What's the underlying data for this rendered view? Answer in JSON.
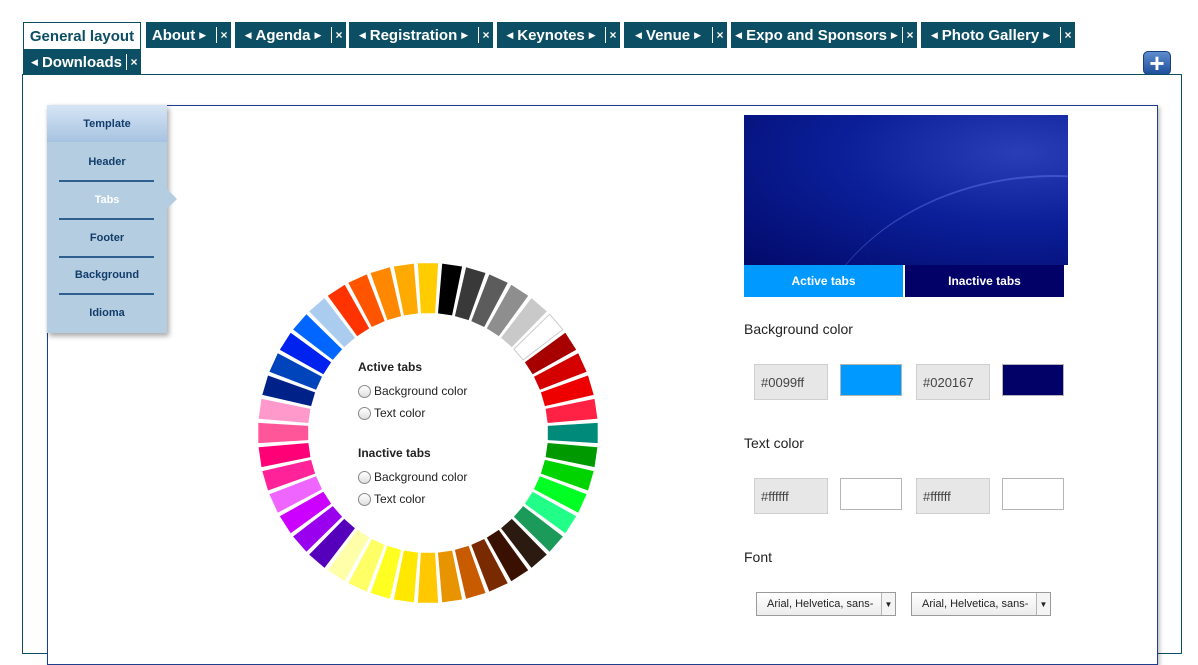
{
  "tabs": [
    {
      "label": "General layout",
      "active": true
    },
    {
      "label": "About",
      "active": false
    },
    {
      "label": "Agenda",
      "active": false
    },
    {
      "label": "Registration",
      "active": false
    },
    {
      "label": "Keynotes",
      "active": false
    },
    {
      "label": "Venue",
      "active": false
    },
    {
      "label": "Expo and Sponsors",
      "active": false
    },
    {
      "label": "Photo Gallery",
      "active": false
    },
    {
      "label": "Downloads",
      "active": false
    }
  ],
  "tab_close_glyph": "×",
  "add_tab_icon": "plus-icon",
  "sidebar": {
    "items": [
      {
        "label": "Template"
      },
      {
        "label": "Header"
      },
      {
        "label": "Tabs",
        "selected": true
      },
      {
        "label": "Footer"
      },
      {
        "label": "Background"
      },
      {
        "label": "Idioma"
      }
    ]
  },
  "wheel": {
    "colors": [
      "#000000",
      "#393939",
      "#5c5c5c",
      "#8e8e8e",
      "#c9c9c9",
      "#ffffff",
      "#a60000",
      "#d40000",
      "#ee0000",
      "#ff2244",
      "#008a7a",
      "#009a00",
      "#00d400",
      "#00ff22",
      "#22ff88",
      "#1c9a5a",
      "#2a1a10",
      "#3a1000",
      "#7a2a00",
      "#c85a00",
      "#e89400",
      "#ffc800",
      "#ffe800",
      "#ffff22",
      "#ffff66",
      "#ffffaa",
      "#5500bb",
      "#9900ee",
      "#cc00ff",
      "#ee66ff",
      "#ff2299",
      "#ff0077",
      "#ff5599",
      "#ff99cc",
      "#002288",
      "#0044bb",
      "#0022ee",
      "#0066ff",
      "#aaccee",
      "#ff3300",
      "#ff5500",
      "#ff8800",
      "#ffaa00",
      "#ffcc00"
    ]
  },
  "options": {
    "active_heading": "Active tabs",
    "inactive_heading": "Inactive tabs",
    "bg_label": "Background color",
    "text_label": "Text color"
  },
  "preview": {
    "active_tab_label": "Active tabs",
    "inactive_tab_label": "Inactive tabs",
    "active_tab_color": "#0099ff",
    "inactive_tab_color": "#020167"
  },
  "background_color": {
    "label": "Background color",
    "active_hex": "#0099ff",
    "inactive_hex": "#020167",
    "active_swatch": "#0099ff",
    "inactive_swatch": "#020167"
  },
  "text_color": {
    "label": "Text color",
    "active_hex": "#ffffff",
    "inactive_hex": "#ffffff",
    "active_swatch": "#ffffff",
    "inactive_swatch": "#ffffff"
  },
  "font": {
    "label": "Font",
    "active_value": "Arial, Helvetica, sans-",
    "inactive_value": "Arial, Helvetica, sans-"
  },
  "colors": {
    "tab_bg": "#0c4f64",
    "panel_border": "#1f3f8c",
    "sidebar_bg": "#b4cde0"
  }
}
